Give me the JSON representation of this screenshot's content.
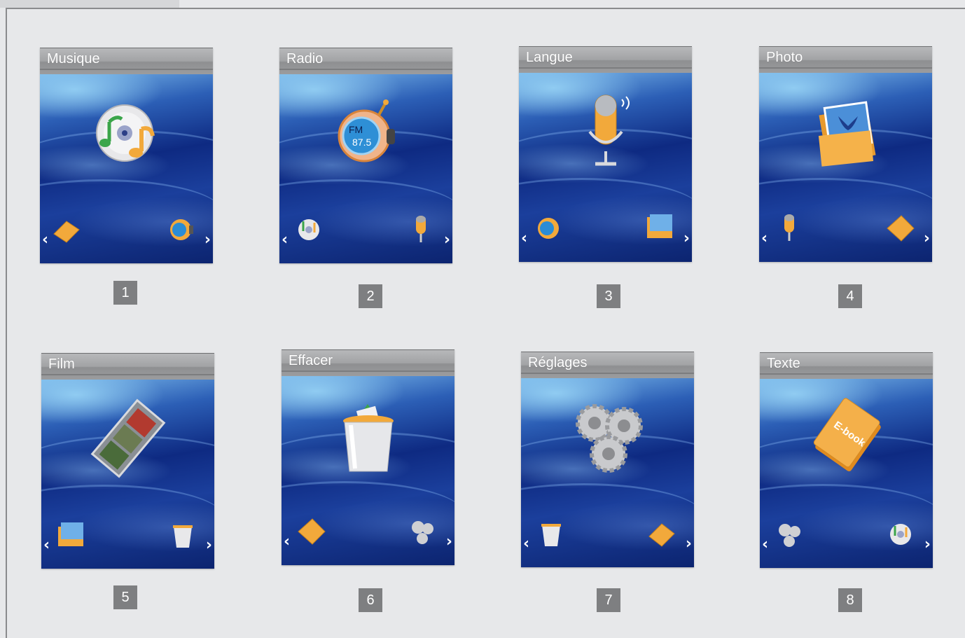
{
  "screens": [
    {
      "title": "Musique",
      "number": "1",
      "main_icon": "music-cd-icon",
      "left_icon": "ebook-icon",
      "right_icon": "radio-icon"
    },
    {
      "title": "Radio",
      "number": "2",
      "main_icon": "radio-icon",
      "radio_label": "FM",
      "radio_freq": "87.5",
      "left_icon": "music-cd-icon",
      "right_icon": "microphone-icon"
    },
    {
      "title": "Langue",
      "number": "3",
      "main_icon": "microphone-icon",
      "left_icon": "radio-icon",
      "right_icon": "photo-folder-icon"
    },
    {
      "title": "Photo",
      "number": "4",
      "main_icon": "photo-folder-icon",
      "left_icon": "microphone-icon",
      "right_icon": "film-icon"
    },
    {
      "title": "Film",
      "number": "5",
      "main_icon": "film-icon",
      "left_icon": "photo-folder-icon",
      "right_icon": "trash-bin-icon"
    },
    {
      "title": "Effacer",
      "number": "6",
      "main_icon": "trash-bin-icon",
      "left_icon": "film-icon",
      "right_icon": "gears-icon"
    },
    {
      "title": "Réglages",
      "number": "7",
      "main_icon": "gears-icon",
      "left_icon": "trash-bin-icon",
      "right_icon": "ebook-icon"
    },
    {
      "title": "Texte",
      "number": "8",
      "main_icon": "ebook-icon",
      "ebook_label": "E-book",
      "left_icon": "gears-icon",
      "right_icon": "music-cd-icon"
    }
  ],
  "nav": {
    "prev_arrow": "‹",
    "next_arrow": "›"
  },
  "colors": {
    "header": "#a2a3a5",
    "number_box": "#7e7f81",
    "background": "#e7e8ea",
    "screen_blue": "#0e2a82",
    "icon_orange": "#f2a93b"
  }
}
